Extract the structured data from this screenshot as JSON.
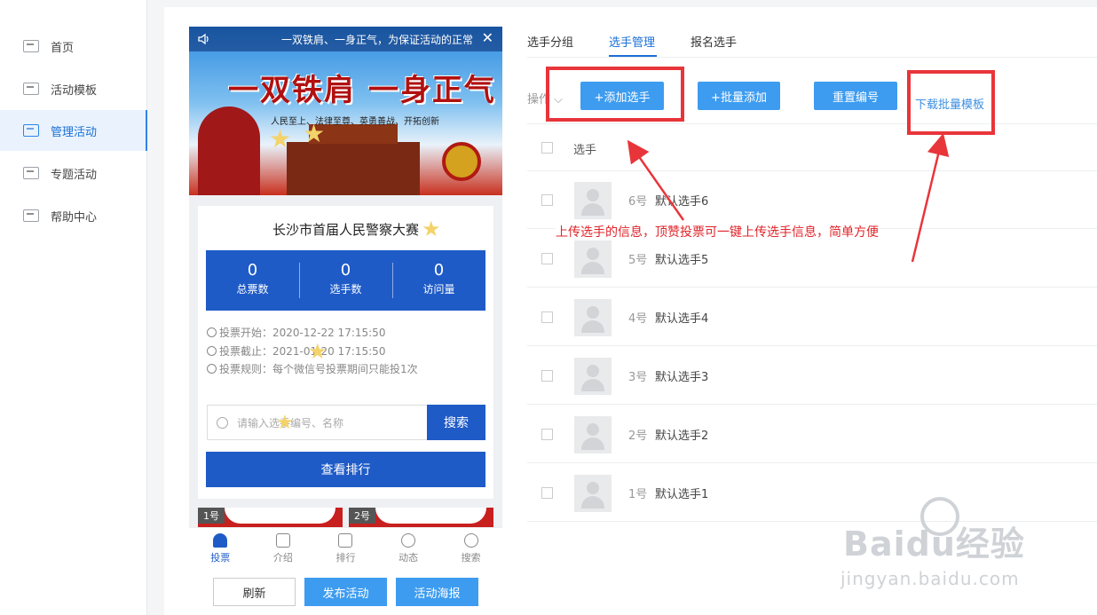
{
  "sidebar": {
    "items": [
      {
        "label": "首页"
      },
      {
        "label": "活动模板"
      },
      {
        "label": "管理活动"
      },
      {
        "label": "专题活动"
      },
      {
        "label": "帮助中心"
      }
    ]
  },
  "preview": {
    "marquee": "一双铁肩、一身正气，为保证活动的正常",
    "banner_title": "一双铁肩 一身正气",
    "banner_slogan": "人民至上、法律至尊、英勇善战、开拓创新",
    "contest_title": "长沙市首届人民警察大赛",
    "stats": [
      {
        "value": "0",
        "label": "总票数"
      },
      {
        "value": "0",
        "label": "选手数"
      },
      {
        "value": "0",
        "label": "访问量"
      }
    ],
    "vote_start": "投票开始：2020-12-22 17:15:50",
    "vote_end": "投票截止：2021-01-20 17:15:50",
    "vote_rule": "投票规则：每个微信号投票期间只能投1次",
    "search_placeholder": "请输入选手编号、名称",
    "search_button": "搜索",
    "rank_button": "查看排行",
    "entries": [
      {
        "no": "1号"
      },
      {
        "no": "2号"
      }
    ],
    "tabs": [
      {
        "label": "投票"
      },
      {
        "label": "介绍"
      },
      {
        "label": "排行"
      },
      {
        "label": "动态"
      },
      {
        "label": "搜索"
      }
    ]
  },
  "bottom_buttons": {
    "refresh": "刷新",
    "publish": "发布活动",
    "poster": "活动海报"
  },
  "top_tabs": [
    {
      "label": "选手分组"
    },
    {
      "label": "选手管理"
    },
    {
      "label": "报名选手"
    }
  ],
  "toolbar": {
    "operation_label": "操作",
    "add": "+添加选手",
    "batch_add": "+批量添加",
    "reset_numbers": "重置编号",
    "download_template": "下载批量模板"
  },
  "table": {
    "column": "选手",
    "rows": [
      {
        "no": "6号",
        "name": "默认选手6"
      },
      {
        "no": "5号",
        "name": "默认选手5"
      },
      {
        "no": "4号",
        "name": "默认选手4"
      },
      {
        "no": "3号",
        "name": "默认选手3"
      },
      {
        "no": "2号",
        "name": "默认选手2"
      },
      {
        "no": "1号",
        "name": "默认选手1"
      }
    ]
  },
  "annotation": "上传选手的信息，顶赞投票可一键上传选手信息，简单方便",
  "watermark": {
    "logo": "Baidu经验",
    "url": "jingyan.baidu.com"
  },
  "colors": {
    "primary_blue": "#1f5bc7",
    "button_blue": "#3d9cf0",
    "annotation_red": "#e8353a",
    "active_nav": "#1a6fd6"
  }
}
